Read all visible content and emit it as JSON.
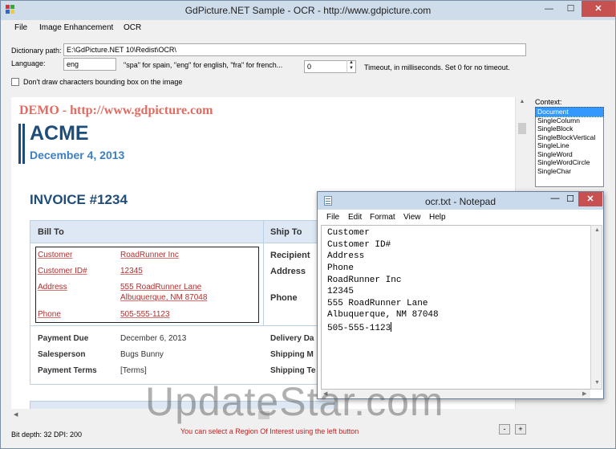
{
  "window": {
    "title": "GdPicture.NET Sample - OCR - http://www.gdpicture.com",
    "min": "—",
    "max": "☐",
    "close": "✕"
  },
  "menu": [
    "File",
    "Image Enhancement",
    "OCR"
  ],
  "dictionary": {
    "label": "Dictionary path:",
    "value": "E:\\GdPicture.NET 10\\Redist\\OCR\\"
  },
  "language": {
    "label": "Language:",
    "value": "eng",
    "hint": "\"spa\" for spain, \"eng\" for english, \"fra\" for french..."
  },
  "timeout": {
    "value": "0",
    "hint": "Timeout, in milliseconds. Set 0 for no timeout."
  },
  "checkbox": {
    "label": "Don't draw characters bounding box on the image",
    "checked": false
  },
  "context": {
    "label": "Context:",
    "items": [
      "Document",
      "SingleColumn",
      "SingleBlock",
      "SingleBlockVertical",
      "SingleLine",
      "SingleWord",
      "SingleWordCircle",
      "SingleChar"
    ],
    "selected": "Document"
  },
  "image": {
    "demo": "DEMO - http://www.gdpicture.com",
    "company": "ACME",
    "date": "December 4, 2013",
    "invoice": "INVOICE #1234",
    "bill_to": "Bill To",
    "ship_to": "Ship To",
    "bill_labels": [
      "Customer",
      "Customer ID#",
      "Address",
      "Phone"
    ],
    "bill_values": [
      "RoadRunner Inc",
      "12345",
      "555 RoadRunner Lane",
      "Albuquerque, NM 87048",
      "505-555-1123"
    ],
    "ship_labels": [
      "Recipient",
      "Address",
      "Phone"
    ],
    "pay_labels": [
      "Payment Due",
      "Salesperson",
      "Payment Terms"
    ],
    "pay_values": [
      "December 6, 2013",
      "Bugs Bunny",
      "[Terms]"
    ],
    "ship2_labels": [
      "Delivery Da",
      "Shipping M",
      "Shipping Te"
    ]
  },
  "status": {
    "depth": "Bit depth:  32 DPI:  200",
    "hint": "You can select a Region Of Interest using the left button",
    "zoom_out": "-",
    "zoom_in": "+"
  },
  "notepad": {
    "title": "ocr.txt - Notepad",
    "menu": [
      "File",
      "Edit",
      "Format",
      "View",
      "Help"
    ],
    "lines": [
      "Customer",
      "Customer ID#",
      "Address",
      "Phone",
      "RoadRunner Inc",
      "12345",
      "555 RoadRunner Lane",
      "Albuquerque, NM 87048",
      "505-555-1123"
    ],
    "min": "—",
    "max": "☐",
    "close": "✕"
  },
  "watermark": "UpdateStar.com",
  "colors": {
    "accent_blue": "#1f4d7a",
    "date_blue": "#3d7fc0",
    "demo_red": "#e06b60",
    "ocr_red": "#b03030",
    "close_red": "#c75050",
    "selection": "#3399ff"
  }
}
